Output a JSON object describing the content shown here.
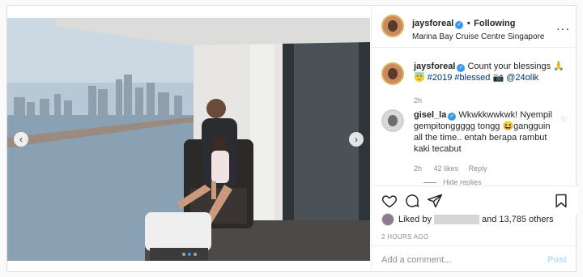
{
  "header": {
    "username": "jaysforeal",
    "follow_label": "Following",
    "location": "Marina Bay Cruise Centre Singapore",
    "dot": "•"
  },
  "caption": {
    "username": "jaysforeal",
    "text": "Count your blessings 🙏",
    "line2": "😇 #2019 #blessed 📷 @24olik",
    "age": "2h"
  },
  "comment": {
    "username": "gisel_la",
    "text": "Wkwkkwwkwk! Nyempil gempitonggggg tongg 😆gangguin all the time.. entah berapa rambut kaki tecabut",
    "age": "2h",
    "likes": "42 likes",
    "reply_label": "Reply",
    "hide_replies_label": "Hide replies"
  },
  "likes": {
    "prefix": "Liked by",
    "suffix": "and 13,785 others"
  },
  "timestamp": "2 HOURS AGO",
  "composer": {
    "placeholder": "Add a comment...",
    "post_label": "Post"
  },
  "photo_nav": {
    "prev": "‹",
    "next": "›",
    "current_index": 2,
    "total": 3
  },
  "colors": {
    "accent": "#3897f0",
    "border": "#dbdbdb",
    "muted": "#8e8e8e",
    "post_disabled": "#b2dffc"
  }
}
